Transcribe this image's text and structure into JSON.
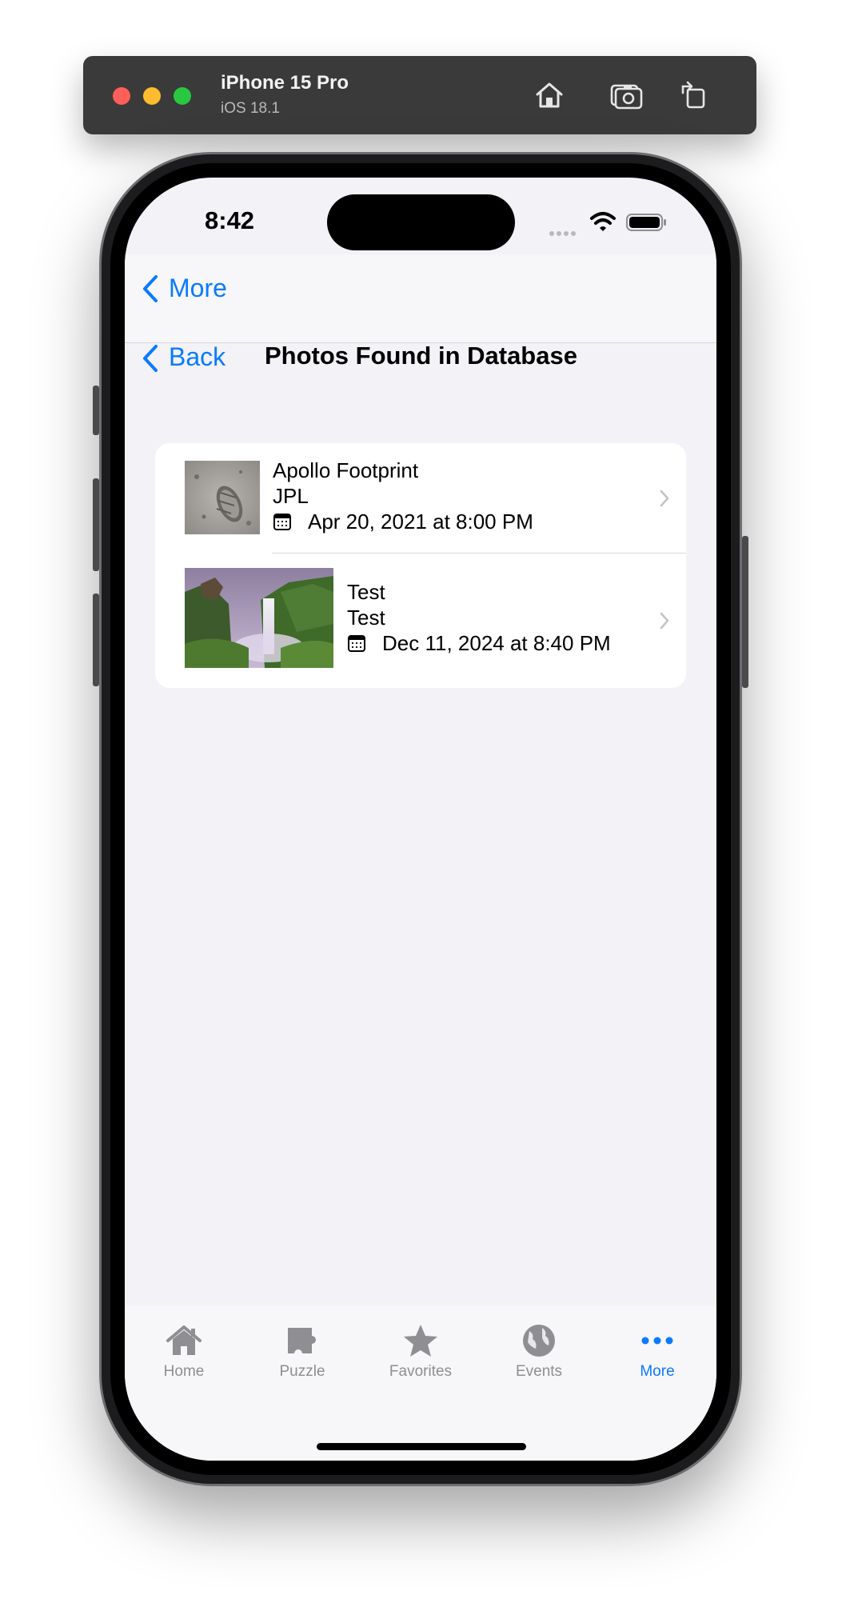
{
  "simulator": {
    "device_name": "iPhone 15 Pro",
    "os_version": "iOS 18.1"
  },
  "status_bar": {
    "time": "8:42"
  },
  "nav": {
    "top_back_label": "More",
    "back_label": "Back",
    "title": "Photos Found in Database"
  },
  "photos": [
    {
      "title": "Apollo Footprint",
      "source": "JPL",
      "date": "Apr 20, 2021 at 8:00 PM"
    },
    {
      "title": "Test",
      "source": "Test",
      "date": "Dec 11, 2024 at 8:40 PM"
    }
  ],
  "tab_bar": {
    "items": [
      {
        "label": "Home",
        "icon": "house-icon"
      },
      {
        "label": "Puzzle",
        "icon": "puzzle-icon"
      },
      {
        "label": "Favorites",
        "icon": "star-icon"
      },
      {
        "label": "Events",
        "icon": "globe-icon"
      },
      {
        "label": "More",
        "icon": "ellipsis-icon"
      }
    ],
    "active": "More"
  },
  "colors": {
    "accent": "#0a7aff",
    "background": "#f2f2f7",
    "inactive_tab": "#8e8e93"
  }
}
